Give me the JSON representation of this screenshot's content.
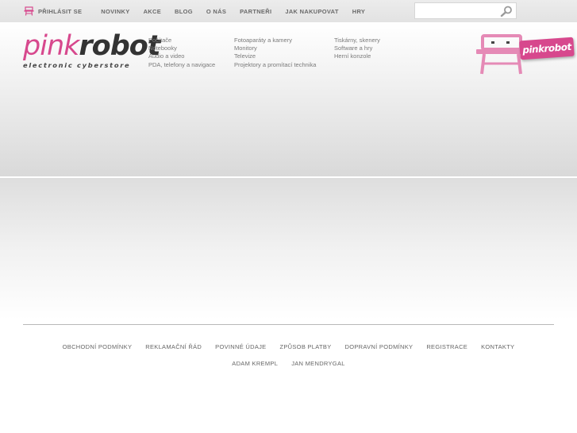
{
  "topnav": {
    "login_label": "PŘIHLÁSIT SE",
    "items": [
      "NOVINKY",
      "AKCE",
      "BLOG",
      "O NÁS",
      "PARTNEŘI",
      "JAK NAKUPOVAT",
      "HRY"
    ],
    "login_icon": "robot-icon",
    "search_icon": "magnifier-icon"
  },
  "search": {
    "value": "",
    "placeholder": ""
  },
  "logo": {
    "part1": "pink",
    "part2": "robot",
    "tagline": "electronic cyberstore"
  },
  "categories": {
    "col1": [
      "Počítače",
      "Notebooky",
      "Audio a video",
      "PDA, telefony a navigace"
    ],
    "col2": [
      "Fotoaparáty a kamery",
      "Monitory",
      "Televize",
      "Projektory a promítací technika"
    ],
    "col3": [
      "Tiskárny, skenery",
      "Software a hry",
      "Herní konzole"
    ]
  },
  "badge": {
    "label": "pinkrobot"
  },
  "footer": {
    "links": [
      "OBCHODNÍ PODMÍNKY",
      "REKLAMAČNÍ ŘÁD",
      "POVINNÉ ÚDAJE",
      "ZPŮSOB PLATBY",
      "DOPRAVNÍ PODMÍNKY",
      "REGISTRACE",
      "KONTAKTY"
    ],
    "authors": [
      "ADAM KREMPL",
      "JAN MENDRYGAL"
    ]
  },
  "colors": {
    "brand_pink": "#d7488d",
    "text_gray": "#666666"
  }
}
